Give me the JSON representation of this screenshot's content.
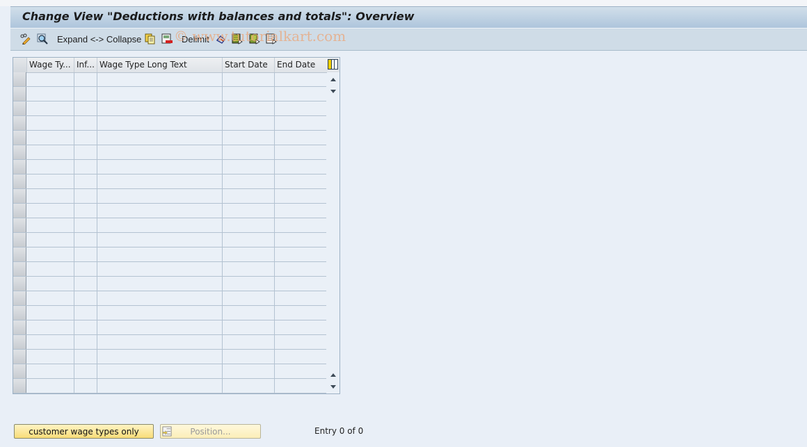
{
  "window": {
    "title": "Change View \"Deductions with balances and totals\": Overview"
  },
  "toolbar": {
    "items": [
      {
        "name": "display-change-icon",
        "label": ""
      },
      {
        "name": "details-icon",
        "label": ""
      },
      {
        "name": "expand-collapse-button",
        "label": "Expand <-> Collapse"
      },
      {
        "name": "copy-as-icon",
        "label": ""
      },
      {
        "name": "delete-icon",
        "label": ""
      },
      {
        "name": "delimit-button",
        "label": "Delimit"
      },
      {
        "name": "undo-change-icon",
        "label": ""
      },
      {
        "name": "select-all-icon",
        "label": ""
      },
      {
        "name": "select-block-icon",
        "label": ""
      },
      {
        "name": "deselect-all-icon",
        "label": ""
      }
    ]
  },
  "watermark": "© www.tutorialkart.com",
  "table": {
    "columns": [
      "Wage Ty...",
      "Inf...",
      "Wage Type Long Text",
      "Start Date",
      "End Date"
    ],
    "rows": [
      [
        "",
        "",
        "",
        "",
        ""
      ],
      [
        "",
        "",
        "",
        "",
        ""
      ],
      [
        "",
        "",
        "",
        "",
        ""
      ],
      [
        "",
        "",
        "",
        "",
        ""
      ],
      [
        "",
        "",
        "",
        "",
        ""
      ],
      [
        "",
        "",
        "",
        "",
        ""
      ],
      [
        "",
        "",
        "",
        "",
        ""
      ],
      [
        "",
        "",
        "",
        "",
        ""
      ],
      [
        "",
        "",
        "",
        "",
        ""
      ],
      [
        "",
        "",
        "",
        "",
        ""
      ],
      [
        "",
        "",
        "",
        "",
        ""
      ],
      [
        "",
        "",
        "",
        "",
        ""
      ],
      [
        "",
        "",
        "",
        "",
        ""
      ],
      [
        "",
        "",
        "",
        "",
        ""
      ],
      [
        "",
        "",
        "",
        "",
        ""
      ],
      [
        "",
        "",
        "",
        "",
        ""
      ],
      [
        "",
        "",
        "",
        "",
        ""
      ],
      [
        "",
        "",
        "",
        "",
        ""
      ],
      [
        "",
        "",
        "",
        "",
        ""
      ],
      [
        "",
        "",
        "",
        "",
        ""
      ],
      [
        "",
        "",
        "",
        "",
        ""
      ],
      [
        "",
        "",
        "",
        "",
        ""
      ]
    ]
  },
  "footer": {
    "customer_button": "customer wage types only",
    "position_button": "Position...",
    "entry_status": "Entry 0 of 0"
  }
}
